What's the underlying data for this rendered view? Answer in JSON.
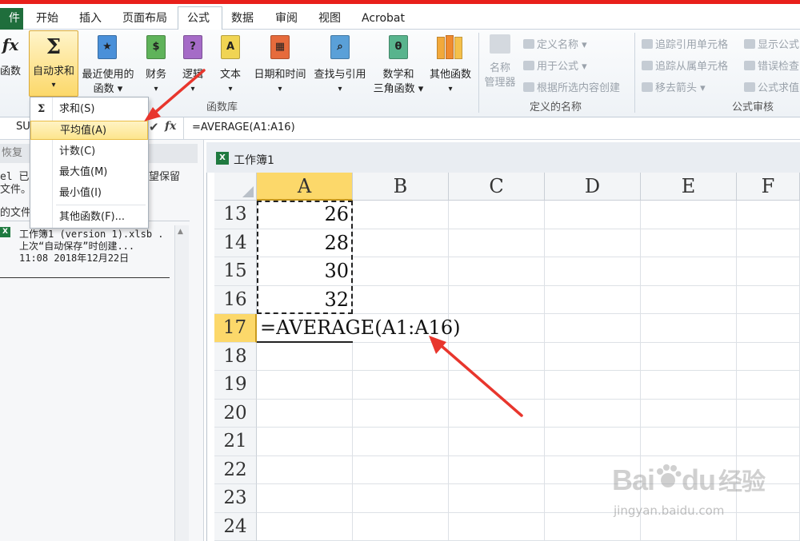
{
  "tabs": {
    "file": "件",
    "home": "开始",
    "insert": "插入",
    "layout": "页面布局",
    "formulas": "公式",
    "data": "数据",
    "review": "审阅",
    "view": "视图",
    "acrobat": "Acrobat"
  },
  "ribbon": {
    "insert_function": "函数",
    "autosum_line1": "自动求和",
    "autosum_arrow": "▾",
    "recent_line1": "最近使用的",
    "recent_line2": "函数 ▾",
    "financial": "财务",
    "logical": "逻辑",
    "text": "文本",
    "datetime": "日期和时间",
    "lookup": "查找与引用",
    "math_line1": "数学和",
    "math_line2": "三角函数 ▾",
    "more": "其他函数",
    "dd_arrow": "▾",
    "function_library_label": "函数库",
    "name_manager_line1": "名称",
    "name_manager_line2": "管理器",
    "define_name": "定义名称 ▾",
    "use_in_formula": "用于公式 ▾",
    "create_from_selection": "根据所选内容创建",
    "defined_names_label": "定义的名称",
    "trace_precedents": "追踪引用单元格",
    "trace_dependents": "追踪从属单元格",
    "remove_arrows": "移去箭头 ▾",
    "show_formulas": "显示公式",
    "error_checking": "错误检查",
    "evaluate_formula": "公式求值",
    "formula_auditing_label": "公式审核"
  },
  "formula_bar": {
    "name_box": "SU",
    "formula": "=AVERAGE(A1:A16)",
    "fx": "fx",
    "check": "✔"
  },
  "dropdown": {
    "items": [
      {
        "label": "求和(S)",
        "icon": "sigma"
      },
      {
        "label": "平均值(A)"
      },
      {
        "label": "计数(C)"
      },
      {
        "label": "最大值(M)"
      },
      {
        "label": "最小值(I)"
      },
      {
        "label": "其他函数(F)..."
      }
    ],
    "selected_index": 1
  },
  "recovery_panel": {
    "title": "恢复",
    "line1": "el 已",
    "line1_right": "望保留",
    "line2": "文件。",
    "section": "的文件",
    "file_name": "工作簿1 (version 1).xlsb .",
    "file_desc": "上次“自动保存”时创建...",
    "file_time": "11:08 2018年12月22日"
  },
  "workbook": {
    "title": "工作簿1",
    "columns": [
      "A",
      "B",
      "C",
      "D",
      "E",
      "F"
    ],
    "rows": [
      {
        "num": "13",
        "a": "26"
      },
      {
        "num": "14",
        "a": "28"
      },
      {
        "num": "15",
        "a": "30"
      },
      {
        "num": "16",
        "a": "32"
      },
      {
        "num": "17",
        "a": "=AVERAGE(A1:A16)"
      },
      {
        "num": "18",
        "a": ""
      },
      {
        "num": "19",
        "a": ""
      },
      {
        "num": "20",
        "a": ""
      },
      {
        "num": "21",
        "a": ""
      },
      {
        "num": "22",
        "a": ""
      },
      {
        "num": "23",
        "a": ""
      },
      {
        "num": "24",
        "a": ""
      }
    ],
    "active_row": "17"
  },
  "watermark": {
    "brand_left": "Bai",
    "brand_right": "du",
    "brand_cn": "经验",
    "url": "jingyan.baidu.com"
  },
  "colors": {
    "arrow_red": "#e8362d",
    "file_tab": "#1f6e3c",
    "selection_yellow": "#fde58d"
  }
}
